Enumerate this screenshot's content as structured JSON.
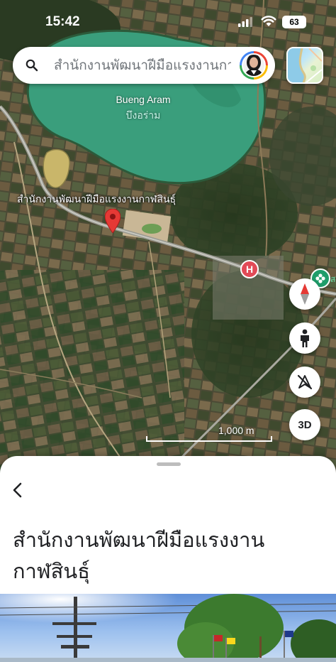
{
  "status_bar": {
    "time": "15:42",
    "battery": "63"
  },
  "search": {
    "text": "สำนักงานพัฒนาฝีมือแรงงานกาฬสินธุ์"
  },
  "map": {
    "lake_label_en": "Bueng Aram",
    "lake_label_th": "บึงอร่าม",
    "place_label": "สำนักงานพัฒนาฝีมือแรงงานกาฬสินธุ์",
    "hospital_symbol": "H",
    "scale_label": "1,000 m",
    "green_poi_partial_text": "ส",
    "controls": {
      "three_d_label": "3D"
    },
    "colors": {
      "lake": "#3a9e7c",
      "pin": "#e53935",
      "hospital": "#e24a57",
      "poi": "#1f9d6a"
    }
  },
  "sheet": {
    "title": "สำนักงานพัฒนาฝีมือแรงงานกาฬสินธุ์"
  }
}
